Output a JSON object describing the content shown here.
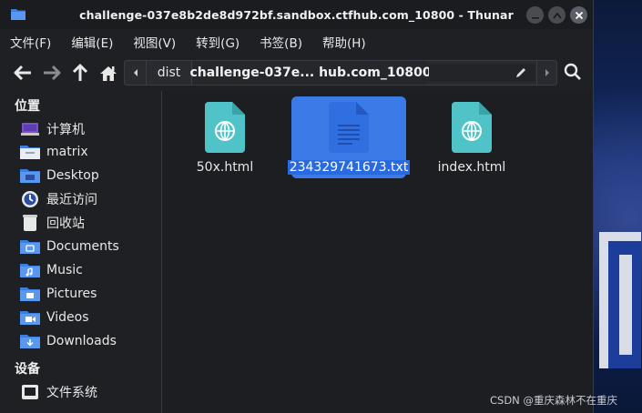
{
  "window": {
    "title": "challenge-037e8b2de8d972bf.sandbox.ctfhub.com_10800 - Thunar"
  },
  "menubar": {
    "items": [
      "文件(F)",
      "编辑(E)",
      "视图(V)",
      "转到(G)",
      "书签(B)",
      "帮助(H)"
    ]
  },
  "toolbar": {
    "icons": [
      "back-arrow-icon",
      "forward-arrow-icon",
      "up-arrow-icon",
      "home-icon"
    ],
    "path": {
      "segments": [
        "dist",
        "challenge-037e... hub.com_10800"
      ]
    }
  },
  "sidebar": {
    "places_header": "位置",
    "places": [
      {
        "label": "计算机",
        "icon": "computer-icon"
      },
      {
        "label": "matrix",
        "icon": "home-folder-icon"
      },
      {
        "label": "Desktop",
        "icon": "desktop-folder-icon"
      },
      {
        "label": "最近访问",
        "icon": "recent-icon"
      },
      {
        "label": "回收站",
        "icon": "trash-icon"
      },
      {
        "label": "Documents",
        "icon": "documents-folder-icon"
      },
      {
        "label": "Music",
        "icon": "music-folder-icon"
      },
      {
        "label": "Pictures",
        "icon": "pictures-folder-icon"
      },
      {
        "label": "Videos",
        "icon": "videos-folder-icon"
      },
      {
        "label": "Downloads",
        "icon": "downloads-folder-icon"
      }
    ],
    "devices_header": "设备",
    "devices": [
      {
        "label": "文件系统",
        "icon": "filesystem-icon"
      }
    ]
  },
  "main": {
    "files": [
      {
        "name": "50x.html",
        "icon": "html-file-icon",
        "selected": false
      },
      {
        "name": "234329741673.txt",
        "icon": "text-file-icon",
        "selected": true
      },
      {
        "name": "index.html",
        "icon": "html-file-icon",
        "selected": false
      }
    ]
  },
  "watermark": "CSDN @重庆森林不在重庆",
  "colors": {
    "selection": "#3a7be8",
    "html_icon": "#4fc3c7",
    "text_icon": "#2f6fe0",
    "folder": "#3b7fe0"
  }
}
